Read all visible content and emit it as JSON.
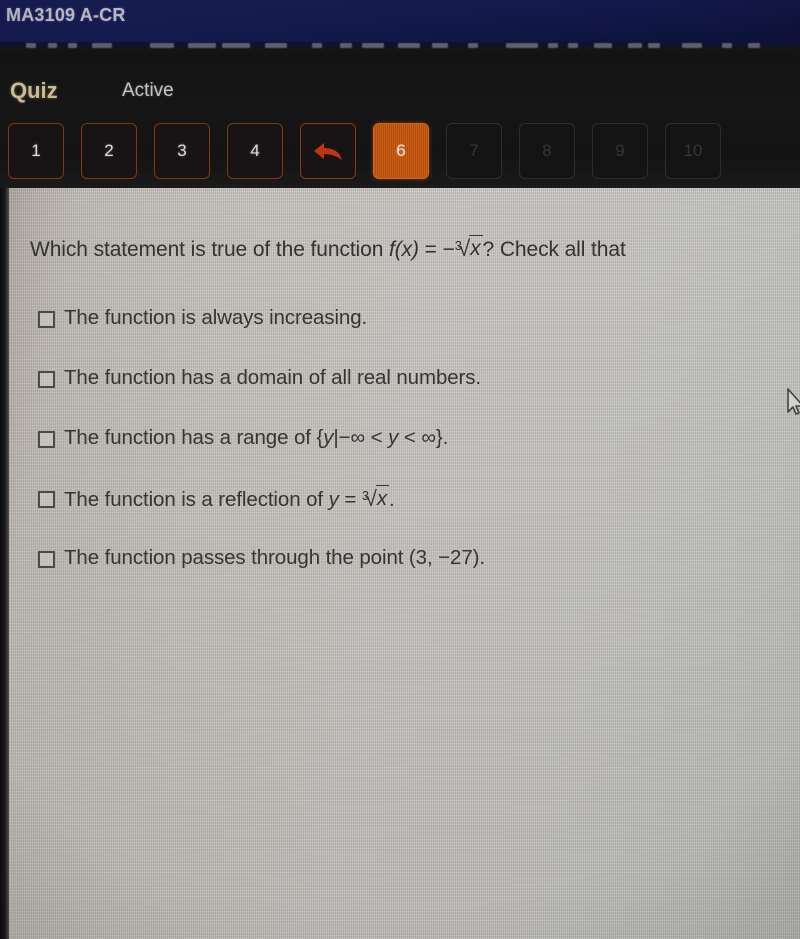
{
  "header": {
    "course_code": "MA3109 A-CR",
    "bg_color": "#141a4e",
    "text_color": "#b9b9c4"
  },
  "quiz_nav": {
    "quiz_label": "Quiz",
    "status_label": "Active",
    "active_color": "#c95c14",
    "border_color": "#7b3a10",
    "back_icon": "back-arrow-icon",
    "buttons": [
      {
        "label": "1",
        "state": "available"
      },
      {
        "label": "2",
        "state": "available"
      },
      {
        "label": "3",
        "state": "available"
      },
      {
        "label": "4",
        "state": "available"
      },
      {
        "label": "",
        "state": "back"
      },
      {
        "label": "6",
        "state": "active"
      },
      {
        "label": "7",
        "state": "disabled"
      },
      {
        "label": "8",
        "state": "disabled"
      },
      {
        "label": "9",
        "state": "disabled"
      },
      {
        "label": "10",
        "state": "disabled"
      }
    ]
  },
  "question": {
    "text_before": "Which statement is true of the function ",
    "fx": "f(x)",
    "equals": " = ",
    "minus": "−",
    "root_degree": "3",
    "root_radicand": "x",
    "text_after": "? Check all that",
    "clipped": true
  },
  "options": [
    {
      "id": "option-always-increasing",
      "checked": false,
      "text": "The function is always increasing.",
      "has_math": false
    },
    {
      "id": "option-domain-all-reals",
      "checked": false,
      "text": "The function has a domain of all real numbers.",
      "has_math": false
    },
    {
      "id": "option-range",
      "checked": false,
      "text": "The function has a range of {y|−∞ < y < ∞}.",
      "has_math": true,
      "prefix": "The function has a range of ",
      "set_open": "{",
      "set_var": "y",
      "set_bar": "|",
      "set_lower": "−∞",
      "set_rel1": " < ",
      "set_var2": "y",
      "set_rel2": " < ",
      "set_upper": "∞",
      "set_close": "}",
      "suffix": "."
    },
    {
      "id": "option-reflection",
      "checked": false,
      "text": "The function is a reflection of y = ∛x.",
      "has_math": true,
      "prefix": "The function is a reflection of ",
      "var": "y",
      "equals": " = ",
      "root_degree": "3",
      "root_radicand": "x",
      "suffix": "."
    },
    {
      "id": "option-point",
      "checked": false,
      "text": "The function passes through the point (3, −27).",
      "has_math": false
    }
  ],
  "cursor": {
    "name": "mouse-pointer-icon",
    "visible": true,
    "partially_offscreen": true
  }
}
